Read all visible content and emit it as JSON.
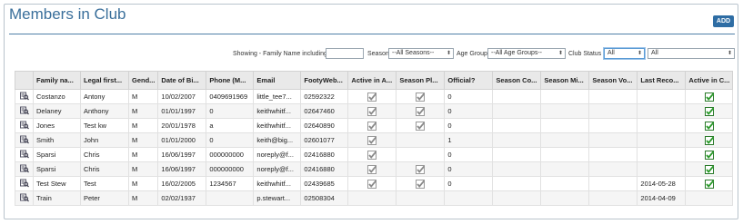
{
  "page": {
    "title": "Members in Club",
    "add_label": "ADD"
  },
  "filters": {
    "family_label": "Showing - Family Name including",
    "family_value": "",
    "season_label": "Season",
    "season_value": "--All Seasons--",
    "age_label": "Age Group",
    "age_value": "--All Age Groups--",
    "status_label": "Club Status",
    "status_value": "All",
    "extra_value": "All"
  },
  "table": {
    "headers": [
      "",
      "Family na...",
      "Legal first...",
      "Gend...",
      "Date of Bi...",
      "Phone (M...",
      "Email",
      "FootyWeb...",
      "Active in A...",
      "Season Pl...",
      "Official?",
      "Season Co...",
      "Season Mi...",
      "Season Vo...",
      "Last Reco...",
      "Active in C..."
    ],
    "rows": [
      {
        "family": "Costanzo",
        "first": "Antony",
        "gender": "M",
        "dob": "10/02/2007",
        "phone": "0409691969",
        "email": "little_tee7...",
        "footyweb": "02592322",
        "active_a": true,
        "season_pl": true,
        "official": "0",
        "last_rec": "",
        "active_c": true
      },
      {
        "family": "Delaney",
        "first": "Anthony",
        "gender": "M",
        "dob": "01/01/1997",
        "phone": "0",
        "email": "keithwhitf...",
        "footyweb": "02647460",
        "active_a": true,
        "season_pl": true,
        "official": "0",
        "last_rec": "",
        "active_c": true
      },
      {
        "family": "Jones",
        "first": "Test kw",
        "gender": "M",
        "dob": "20/01/1978",
        "phone": "a",
        "email": "keithwhitf...",
        "footyweb": "02640890",
        "active_a": true,
        "season_pl": true,
        "official": "0",
        "last_rec": "",
        "active_c": true
      },
      {
        "family": "Smith",
        "first": "John",
        "gender": "M",
        "dob": "01/01/2000",
        "phone": "0",
        "email": "keith@big...",
        "footyweb": "02601077",
        "active_a": true,
        "season_pl": false,
        "official": "1",
        "last_rec": "",
        "active_c": true
      },
      {
        "family": "Sparsi",
        "first": "Chris",
        "gender": "M",
        "dob": "16/06/1997",
        "phone": "000000000",
        "email": "noreply@f...",
        "footyweb": "02416880",
        "active_a": true,
        "season_pl": false,
        "official": "0",
        "last_rec": "",
        "active_c": true
      },
      {
        "family": "Sparsi",
        "first": "Chris",
        "gender": "M",
        "dob": "16/06/1997",
        "phone": "000000000",
        "email": "noreply@f...",
        "footyweb": "02416880",
        "active_a": true,
        "season_pl": true,
        "official": "0",
        "last_rec": "",
        "active_c": true
      },
      {
        "family": "Test Stew",
        "first": "Test",
        "gender": "M",
        "dob": "16/02/2005",
        "phone": "1234567",
        "email": "keithwhitf...",
        "footyweb": "02439685",
        "active_a": true,
        "season_pl": true,
        "official": "0",
        "last_rec": "2014-05-28",
        "active_c": true
      },
      {
        "family": "Train",
        "first": "Peter",
        "gender": "M",
        "dob": "02/02/1937",
        "phone": "",
        "email": "p.stewart...",
        "footyweb": "02508304",
        "active_a": false,
        "season_pl": false,
        "official": "",
        "last_rec": "2014-04-09",
        "active_c": false
      }
    ]
  },
  "colors": {
    "title": "#3a6f9b",
    "accent": "#2e6da4",
    "check_green": "#2a9a2a"
  },
  "icons": {
    "row_view": "view-record-icon",
    "checked_grey": "checkbox-grey-icon",
    "checked_green": "checkbox-green-icon"
  }
}
